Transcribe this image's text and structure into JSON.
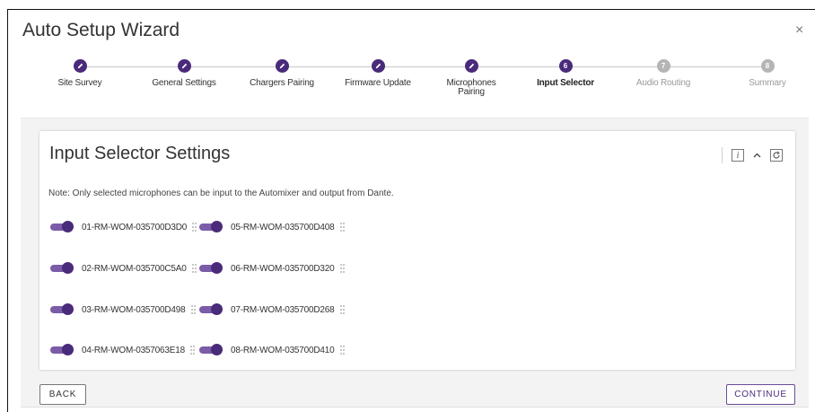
{
  "window": {
    "title": "Auto Setup Wizard",
    "close_label": "×"
  },
  "steps": [
    {
      "label": "Site Survey",
      "state": "done",
      "number": ""
    },
    {
      "label": "General Settings",
      "state": "done",
      "number": ""
    },
    {
      "label": "Chargers Pairing",
      "state": "done",
      "number": ""
    },
    {
      "label": "Firmware Update",
      "state": "done",
      "number": ""
    },
    {
      "label": "Microphones Pairing",
      "state": "done",
      "number": ""
    },
    {
      "label": "Input Selector",
      "state": "active",
      "number": "6"
    },
    {
      "label": "Audio Routing",
      "state": "pending",
      "number": "7"
    },
    {
      "label": "Summary",
      "state": "pending",
      "number": "8"
    }
  ],
  "card": {
    "title": "Input Selector Settings",
    "info_label": "i",
    "collapse_label": "^",
    "note": "Note: Only selected microphones can be input to the Automixer and output from Dante."
  },
  "microphones": [
    {
      "name": "01-RM-WOM-035700D3D0",
      "enabled": true
    },
    {
      "name": "02-RM-WOM-035700C5A0",
      "enabled": true
    },
    {
      "name": "03-RM-WOM-035700D498",
      "enabled": true
    },
    {
      "name": "04-RM-WOM-0357063E18",
      "enabled": true
    },
    {
      "name": "05-RM-WOM-035700D408",
      "enabled": true
    },
    {
      "name": "06-RM-WOM-035700D320",
      "enabled": true
    },
    {
      "name": "07-RM-WOM-035700D268",
      "enabled": true
    },
    {
      "name": "08-RM-WOM-035700D410",
      "enabled": true
    }
  ],
  "buttons": {
    "back": "BACK",
    "continue": "CONTINUE"
  },
  "colors": {
    "accent": "#4a2a7a",
    "toggle_track": "#7a5ca8",
    "pending": "#b5b5b5"
  }
}
